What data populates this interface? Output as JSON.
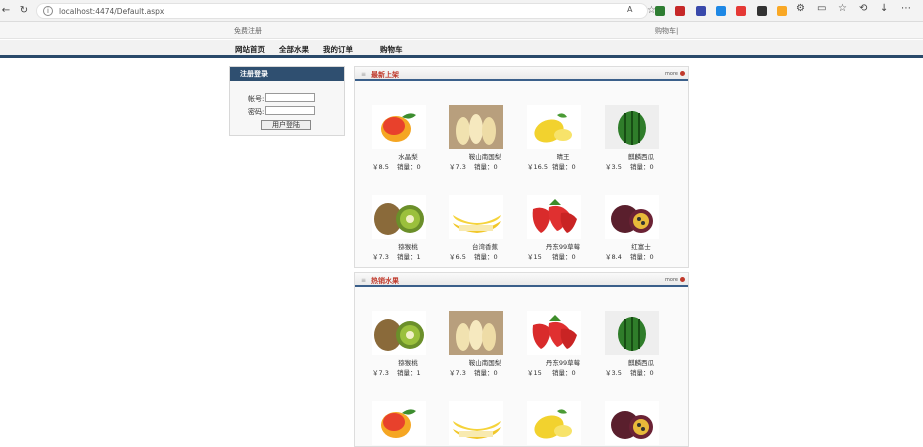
{
  "browser": {
    "url": "localhost:4474/Default.aspx"
  },
  "site": {
    "register_link": "免费注册",
    "cart_link": "购物车|",
    "menu": [
      "网站首页",
      "全部水果",
      "我的订单",
      "购物车"
    ]
  },
  "login": {
    "title": "注册登录",
    "account_label": "帐号:",
    "password_label": "密码:",
    "login_button": "用户登陆"
  },
  "sections": [
    {
      "title": "最新上架",
      "more": "more",
      "products": [
        {
          "name": "水晶梨",
          "price": "￥8.5",
          "sales": "销量：0",
          "fruit": "peach"
        },
        {
          "name": "鞍山南国梨",
          "price": "￥7.3",
          "sales": "销量：0",
          "fruit": "pear"
        },
        {
          "name": "晴王",
          "price": "￥16.5",
          "sales": "销量：0",
          "fruit": "mango"
        },
        {
          "name": "麒麟西瓜",
          "price": "￥3.5",
          "sales": "销量：0",
          "fruit": "watermelon"
        },
        {
          "name": "猕猴桃",
          "price": "￥7.3",
          "sales": "销量：1",
          "fruit": "kiwi"
        },
        {
          "name": "台湾香蕉",
          "price": "￥6.5",
          "sales": "销量：0",
          "fruit": "banana"
        },
        {
          "name": "丹东99草莓",
          "price": "￥15",
          "sales": "销量：0",
          "fruit": "strawberry"
        },
        {
          "name": "红富士",
          "price": "￥8.4",
          "sales": "销量：0",
          "fruit": "passionfruit"
        }
      ]
    },
    {
      "title": "热销水果",
      "more": "more",
      "products": [
        {
          "name": "猕猴桃",
          "price": "￥7.3",
          "sales": "销量：1",
          "fruit": "kiwi"
        },
        {
          "name": "鞍山南国梨",
          "price": "￥7.3",
          "sales": "销量：0",
          "fruit": "pear"
        },
        {
          "name": "丹东99草莓",
          "price": "￥15",
          "sales": "销量：0",
          "fruit": "strawberry"
        },
        {
          "name": "麒麟西瓜",
          "price": "￥3.5",
          "sales": "销量：0",
          "fruit": "watermelon"
        },
        {
          "name": "",
          "price": "",
          "sales": "",
          "fruit": "peach"
        },
        {
          "name": "",
          "price": "",
          "sales": "",
          "fruit": "banana"
        },
        {
          "name": "",
          "price": "",
          "sales": "",
          "fruit": "mango"
        },
        {
          "name": "",
          "price": "",
          "sales": "",
          "fruit": "passionfruit"
        }
      ]
    }
  ]
}
